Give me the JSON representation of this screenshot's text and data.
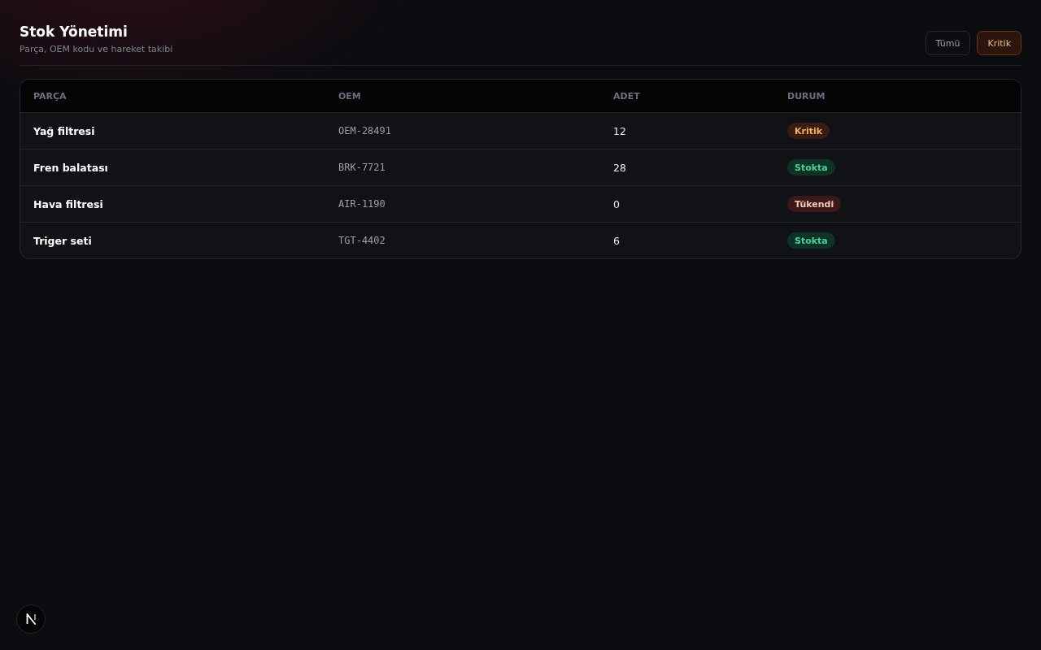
{
  "header": {
    "title": "Stok Yönetimi",
    "subtitle": "Parça, OEM kodu ve hareket takibi"
  },
  "filters": [
    {
      "label": "Tümü",
      "selected": false
    },
    {
      "label": "Kritik",
      "selected": true
    }
  ],
  "table": {
    "columns": [
      "PARÇA",
      "OEM",
      "ADET",
      "DURUM"
    ],
    "rows": [
      {
        "part": "Yağ filtresi",
        "oem": "OEM-28491",
        "quantity": "12",
        "status": {
          "label": "Kritik",
          "kind": "critical"
        }
      },
      {
        "part": "Fren balatası",
        "oem": "BRK-7721",
        "quantity": "28",
        "status": {
          "label": "Stokta",
          "kind": "in_stock"
        }
      },
      {
        "part": "Hava filtresi",
        "oem": "AIR-1190",
        "quantity": "0",
        "status": {
          "label": "Tükendi",
          "kind": "out_of_stock"
        }
      },
      {
        "part": "Triger seti",
        "oem": "TGT-4402",
        "quantity": "6",
        "status": {
          "label": "Stokta",
          "kind": "in_stock"
        }
      }
    ]
  },
  "dev_indicator": {
    "kind": "logo"
  }
}
